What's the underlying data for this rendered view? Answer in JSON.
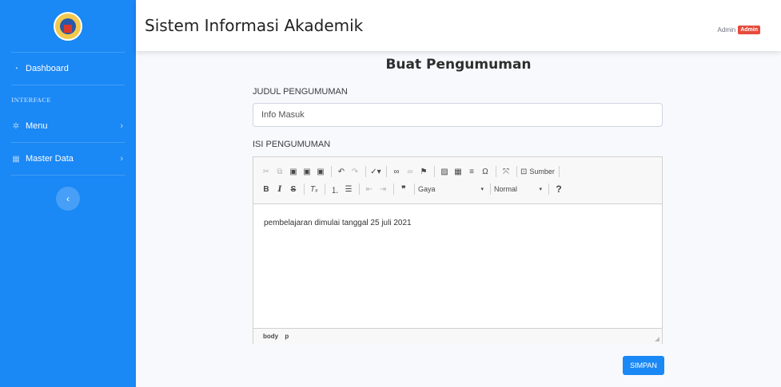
{
  "sidebar": {
    "items": [
      {
        "label": "Dashboard",
        "icon": "dashboard-icon"
      },
      {
        "label": "Menu",
        "icon": "gear-icon"
      },
      {
        "label": "Master Data",
        "icon": "table-icon"
      }
    ],
    "section_heading": "INTERFACE"
  },
  "topbar": {
    "title": "Sistem Informasi Akademik",
    "user_name": "Admin",
    "user_badge": "Admin"
  },
  "form": {
    "heading": "Buat Pengumuman",
    "title_label": "JUDUL PENGUMUMAN",
    "title_value": "Info Masuk",
    "content_label": "ISI PENGUMUMAN",
    "content_value": "pembelajaran dimulai tanggal 25 juli 2021",
    "submit_label": "SIMPAN"
  },
  "editor": {
    "source_label": "Sumber",
    "style_select": "Gaya",
    "format_select": "Normal",
    "help": "?",
    "path": [
      "body",
      "p"
    ]
  },
  "colors": {
    "sidebar": "#1a88f5",
    "primary_button": "#1a88f5",
    "badge": "#e74a3b"
  }
}
